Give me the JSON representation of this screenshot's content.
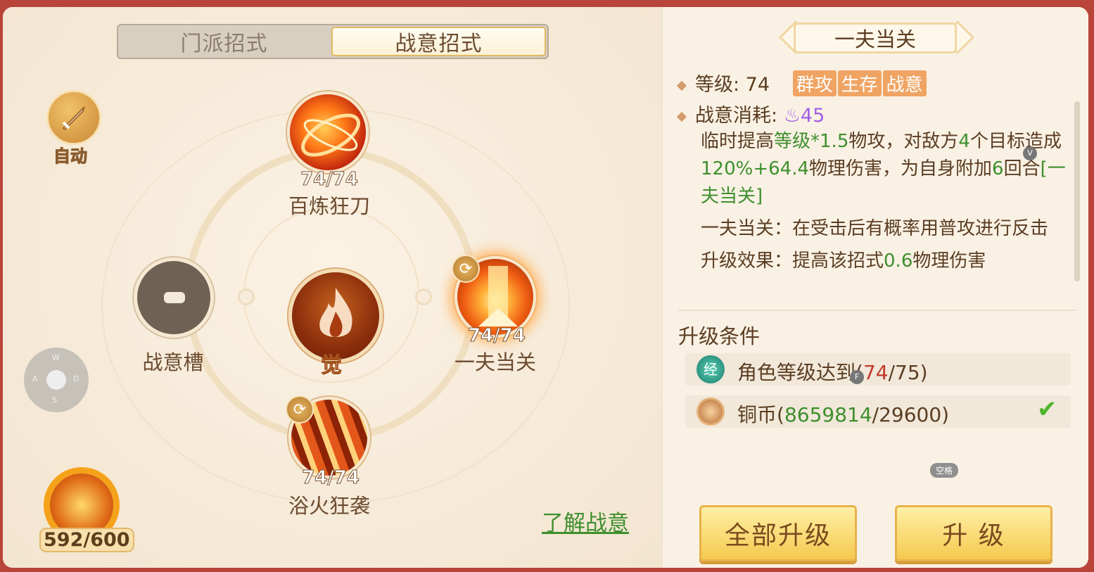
{
  "tabs": [
    {
      "label": "门派招式",
      "active": false
    },
    {
      "label": "战意招式",
      "active": true
    }
  ],
  "auto_button": {
    "label": "自动"
  },
  "skills": {
    "top": {
      "name": "百炼狂刀",
      "level": "74/74"
    },
    "right": {
      "name": "一夫当关",
      "level": "74/74"
    },
    "bottom": {
      "name": "浴火狂袭",
      "level": "74/74"
    },
    "left_slot": {
      "name": "战意槽"
    },
    "center": {
      "label": "觉"
    }
  },
  "joystick": {
    "up": "W",
    "left": "A",
    "right": "D",
    "down": "S"
  },
  "energy": {
    "value": "592/600"
  },
  "learn_link": "了解战意",
  "detail": {
    "title": "一夫当关",
    "level_label": "等级: 74",
    "tags": [
      "群攻",
      "生存",
      "战意"
    ],
    "cost_label": "战意消耗:",
    "cost_value": "45",
    "desc_parts": {
      "p1": "临时提高",
      "p2": "等级*1.5",
      "p3": "物攻，对敌方",
      "p4": "4",
      "p5": "个目标造成",
      "p6": "120%+64.4",
      "p7": "物理伤害，为自身附加",
      "p8": "6",
      "p9": "回合",
      "p10": "[一夫当关]"
    },
    "effect": "一夫当关：在受击后有概率用普攻进行反击",
    "upgrade_prefix": "升级效果：提高该招式",
    "upgrade_value": "0.6",
    "upgrade_suffix": "物理伤害"
  },
  "upgrade": {
    "section_title": "升级条件",
    "conditions": [
      {
        "icon": "exp-icon",
        "icon_text": "经",
        "prefix": "角色等级达到(",
        "current": "74",
        "sep": "/",
        "target": "75",
        "suffix": ")"
      },
      {
        "icon": "coin-icon",
        "prefix": "铜币(",
        "current": "8659814",
        "sep": "/",
        "target": "29600",
        "suffix": ")",
        "met": true
      }
    ]
  },
  "hint": "空格",
  "tip_v": "V",
  "tip_f": "F",
  "buttons": {
    "upgrade_all": "全部升级",
    "upgrade": "升 级"
  }
}
